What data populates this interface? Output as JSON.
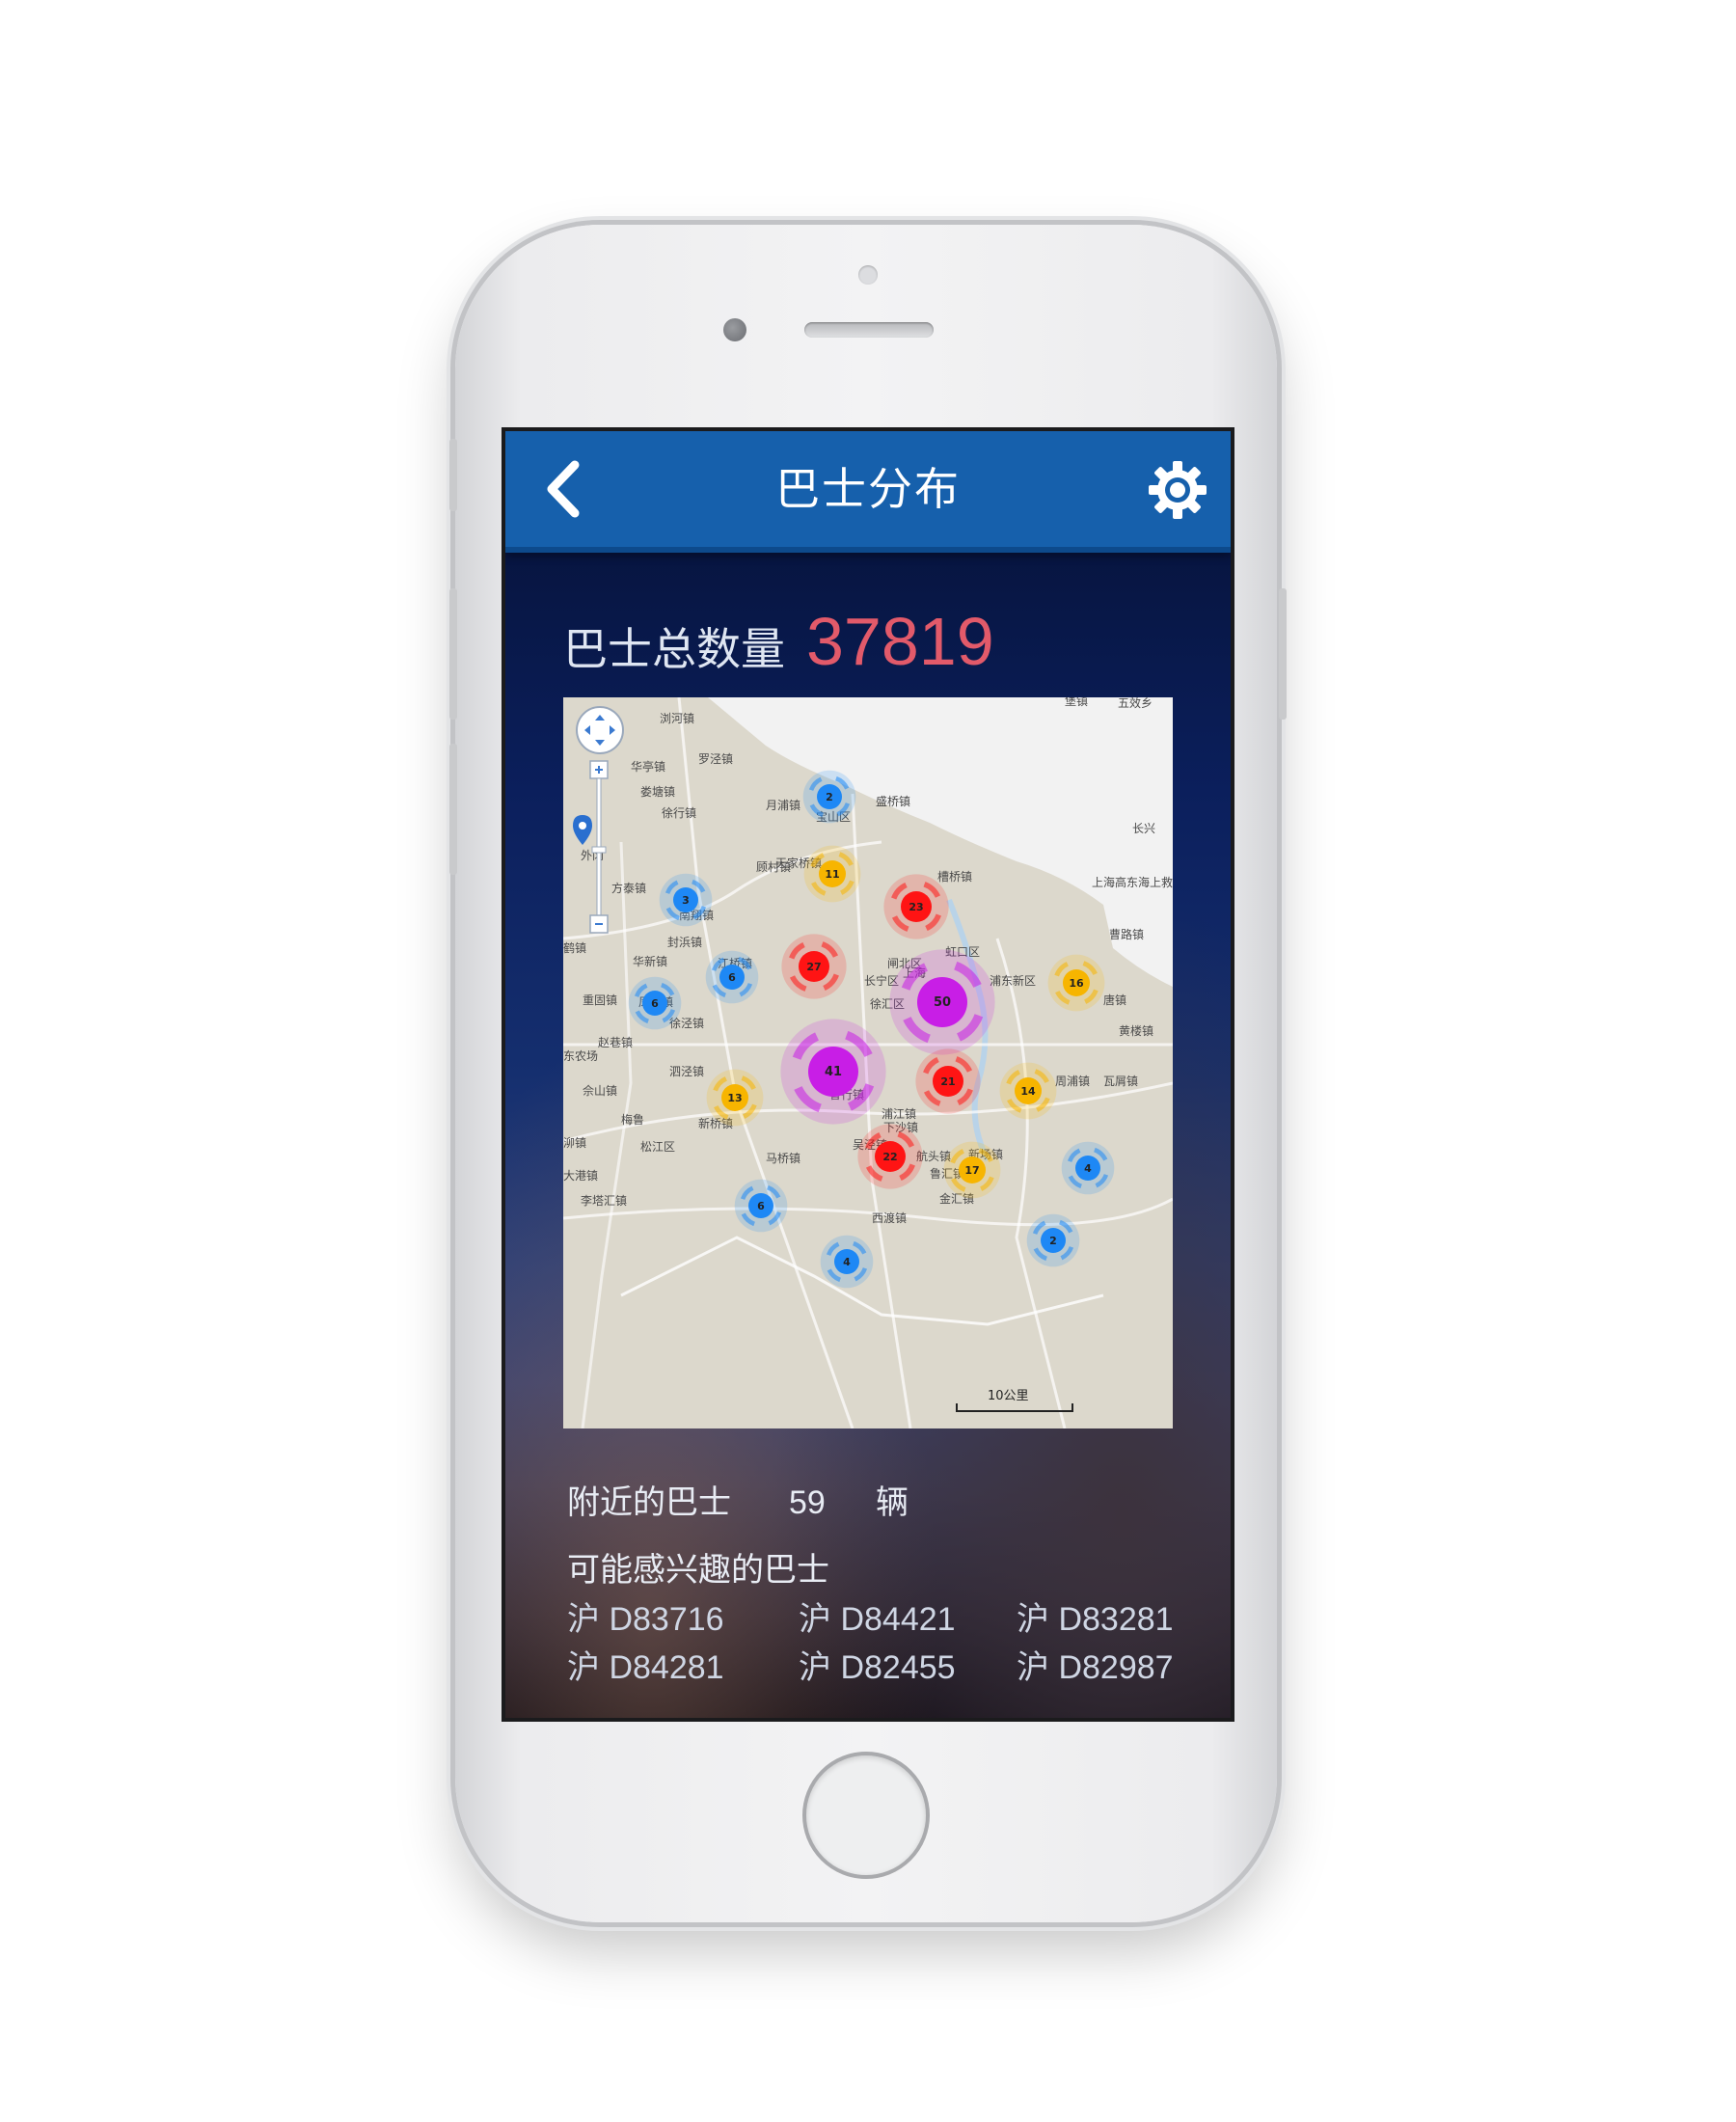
{
  "app": {
    "nav_title": "巴士分布",
    "total_label": "巴士总数量",
    "total_value": "37819",
    "nearby_label": "附近的巴士",
    "nearby_count": "59",
    "nearby_unit": "辆",
    "interest_title": "可能感兴趣的巴士",
    "plates": [
      "沪 D83716",
      "沪 D84421",
      "沪 D83281",
      "沪 D84281",
      "沪 D82455",
      "沪 D82987"
    ],
    "icons": {
      "back": "chevron-left-icon",
      "settings": "gear-icon",
      "zoom_in": "plus-icon",
      "zoom_out": "minus-icon",
      "pan": "pan-control-icon",
      "location": "location-pin-icon"
    },
    "colors": {
      "navbar": "#1660ac",
      "total_value": "#e25a6a",
      "cluster_small": "#1e88f5",
      "cluster_medium": "#f7b500",
      "cluster_large": "#ff1414",
      "cluster_xlarge": "#c81ee6"
    }
  },
  "map": {
    "scale_label": "10公里",
    "clusters": [
      {
        "count": 2,
        "level": "small"
      },
      {
        "count": 11,
        "level": "medium"
      },
      {
        "count": 3,
        "level": "small"
      },
      {
        "count": 23,
        "level": "large"
      },
      {
        "count": 27,
        "level": "large"
      },
      {
        "count": 6,
        "level": "small"
      },
      {
        "count": 50,
        "level": "xlarge"
      },
      {
        "count": 16,
        "level": "medium"
      },
      {
        "count": 6,
        "level": "small"
      },
      {
        "count": 41,
        "level": "xlarge"
      },
      {
        "count": 21,
        "level": "large"
      },
      {
        "count": 14,
        "level": "medium"
      },
      {
        "count": 13,
        "level": "medium"
      },
      {
        "count": 22,
        "level": "large"
      },
      {
        "count": 17,
        "level": "medium"
      },
      {
        "count": 4,
        "level": "small"
      },
      {
        "count": 6,
        "level": "small"
      },
      {
        "count": 2,
        "level": "small"
      },
      {
        "count": 4,
        "level": "small"
      }
    ],
    "labels": [
      "浏河镇",
      "罗泾镇",
      "华亭镇",
      "娄塘镇",
      "徐行镇",
      "月浦镇",
      "宝山区",
      "顾村镇",
      "方泰镇",
      "南翔镇",
      "封浜镇",
      "华新镇",
      "江桥镇",
      "重固镇",
      "凤溪镇",
      "徐泾镇",
      "赵巷镇",
      "泗泾镇",
      "佘山镇",
      "新桥镇",
      "闵行区",
      "曹行镇",
      "浦江镇",
      "下沙镇",
      "航头镇",
      "新场镇",
      "马桥镇",
      "吴泾镇",
      "鲁汇镇",
      "松江区",
      "金汇镇",
      "西渡镇",
      "李塔汇镇",
      "黄楼镇",
      "瓦屑镇",
      "唐镇",
      "曹路镇",
      "上海高东海上救助机场",
      "长兴",
      "堡镇",
      "五效乡",
      "徐汇区",
      "长宁区",
      "闸北区",
      "虹口区",
      "浦东新区",
      "上海",
      "东农场",
      "大港镇",
      "周浦镇",
      "槽桥镇",
      "盛桥镇",
      "天家桥镇",
      "外冈",
      "鹤镇",
      "梅鲁",
      "泖镇"
    ]
  }
}
